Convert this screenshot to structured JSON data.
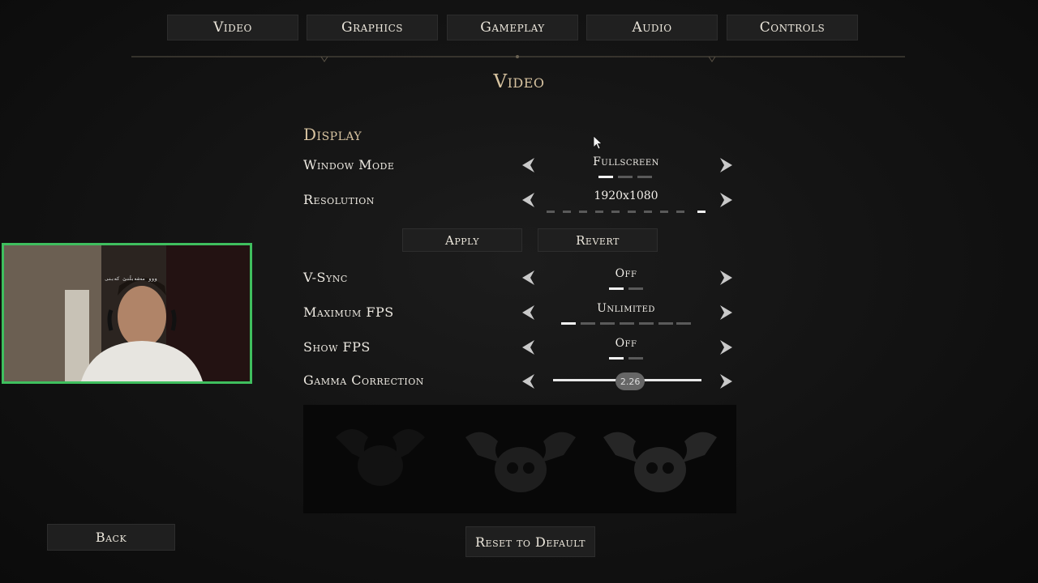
{
  "tabs": [
    {
      "label": "Video",
      "active": true
    },
    {
      "label": "Graphics",
      "active": false
    },
    {
      "label": "Gameplay",
      "active": false
    },
    {
      "label": "Audio",
      "active": false
    },
    {
      "label": "Controls",
      "active": false
    }
  ],
  "page_title": "Video",
  "section": {
    "heading": "Display"
  },
  "settings": {
    "window_mode": {
      "label": "Window Mode",
      "value": "Fullscreen",
      "options_count": 3,
      "selected_index": 0
    },
    "resolution": {
      "label": "Resolution",
      "value": "1920x1080",
      "options_count": 10,
      "selected_index": 9
    },
    "vsync": {
      "label": "V-Sync",
      "value": "Off",
      "options_count": 2,
      "selected_index": 0
    },
    "max_fps": {
      "label": "Maximum FPS",
      "value": "Unlimited",
      "options_count": 7,
      "selected_index": 0
    },
    "show_fps": {
      "label": "Show FPS",
      "value": "Off",
      "options_count": 2,
      "selected_index": 0
    },
    "gamma": {
      "label": "Gamma Correction",
      "value": "2.26",
      "level_fraction": 0.52
    }
  },
  "buttons": {
    "apply": "Apply",
    "revert": "Revert",
    "back": "Back",
    "reset": "Reset to Default"
  },
  "webcam": {
    "overlay_text": "ووو مەشەبڵنێ کەبنی"
  },
  "colors": {
    "title_gold": "#d7c3a0",
    "webcam_border": "#3fbf5e",
    "background": "#141414"
  },
  "icons": {
    "prev": "chevron-left-icon",
    "next": "chevron-right-icon"
  }
}
